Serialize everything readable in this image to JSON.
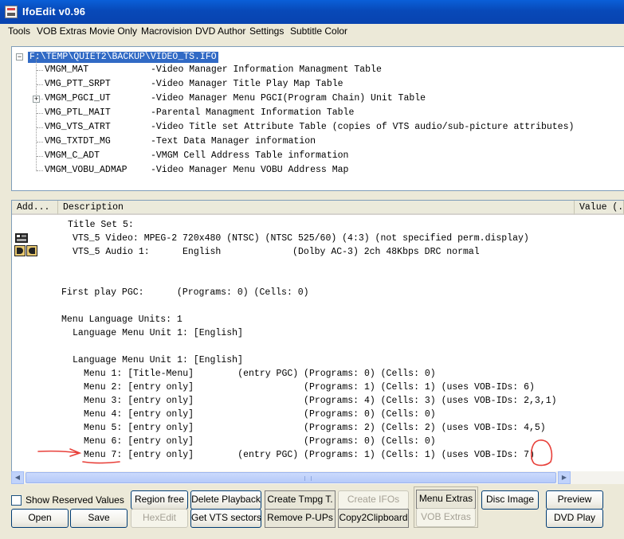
{
  "window": {
    "title": "IfoEdit v0.96"
  },
  "menu": [
    "Tools",
    "VOB Extras",
    "Movie Only",
    "Macrovision",
    "DVD Author",
    "Settings",
    "Subtitle Color"
  ],
  "tree": {
    "root": "F:\\TEMP\\QUIET2\\BACKUP\\VIDEO_TS.IFO",
    "items": [
      {
        "name": "VMGM_MAT",
        "desc": "-Video Manager Information Managment Table"
      },
      {
        "name": "VMG_PTT_SRPT",
        "desc": "-Video Manager Title Play Map Table"
      },
      {
        "name": "VMGM_PGCI_UT",
        "desc": "-Video Manager Menu PGCI(Program Chain) Unit Table"
      },
      {
        "name": "VMG_PTL_MAIT",
        "desc": "-Parental Managment Information Table"
      },
      {
        "name": "VMG_VTS_ATRT",
        "desc": "-Video Title set Attribute Table (copies of VTS audio/sub-picture attributes)"
      },
      {
        "name": "VMG_TXTDT_MG",
        "desc": "-Text Data Manager information"
      },
      {
        "name": "VMGM_C_ADT",
        "desc": "-VMGM Cell Address Table information"
      },
      {
        "name": "VMGM_VOBU_ADMAP",
        "desc": "-Video Manager Menu VOBU Address Map"
      }
    ]
  },
  "list": {
    "headers": {
      "addr": "Add...",
      "desc": "Description",
      "value": "Value (..."
    },
    "lines": [
      "Title Set 5:",
      "VTS_5 Video: MPEG-2 720x480 (NTSC) (NTSC 525/60) (4:3) (not specified perm.display)",
      "VTS_5 Audio 1:      English             (Dolby AC-3) 2ch 48Kbps DRC normal",
      "First play PGC:      (Programs: 0) (Cells: 0)",
      "Menu Language Units: 1",
      "Language Menu Unit 1: [English]",
      "Language Menu Unit 1: [English]",
      "Menu 1: [Title-Menu]        (entry PGC) (Programs: 0) (Cells: 0)",
      "Menu 2: [entry only]                    (Programs: 1) (Cells: 1) (uses VOB-IDs: 6)",
      "Menu 3: [entry only]                    (Programs: 4) (Cells: 3) (uses VOB-IDs: 2,3,1)",
      "Menu 4: [entry only]                    (Programs: 0) (Cells: 0)",
      "Menu 5: [entry only]                    (Programs: 2) (Cells: 2) (uses VOB-IDs: 4,5)",
      "Menu 6: [entry only]                    (Programs: 0) (Cells: 0)",
      "Menu 7: [entry only]        (entry PGC) (Programs: 1) (Cells: 1) (uses VOB-IDs: 7)"
    ]
  },
  "controls": {
    "show_reserved": "Show Reserved Values",
    "open": "Open",
    "save": "Save",
    "region_free": "Region free",
    "hexedit": "HexEdit",
    "delete_playback": "Delete Playback",
    "get_vts_sectors": "Get VTS sectors",
    "create_tmpg": "Create Tmpg T.",
    "remove_pups": "Remove P-UPs",
    "create_ifos": "Create IFOs",
    "copy2clipboard": "Copy2Clipboard",
    "menu_extras": "Menu Extras",
    "vob_extras": "VOB Extras",
    "disc_image": "Disc Image",
    "preview": "Preview",
    "dvd_play": "DVD Play"
  },
  "colors": {
    "titlebar": "#0a5fd8",
    "selection": "#316ac5",
    "annotation": "#e8403a",
    "face": "#ece9d8"
  }
}
